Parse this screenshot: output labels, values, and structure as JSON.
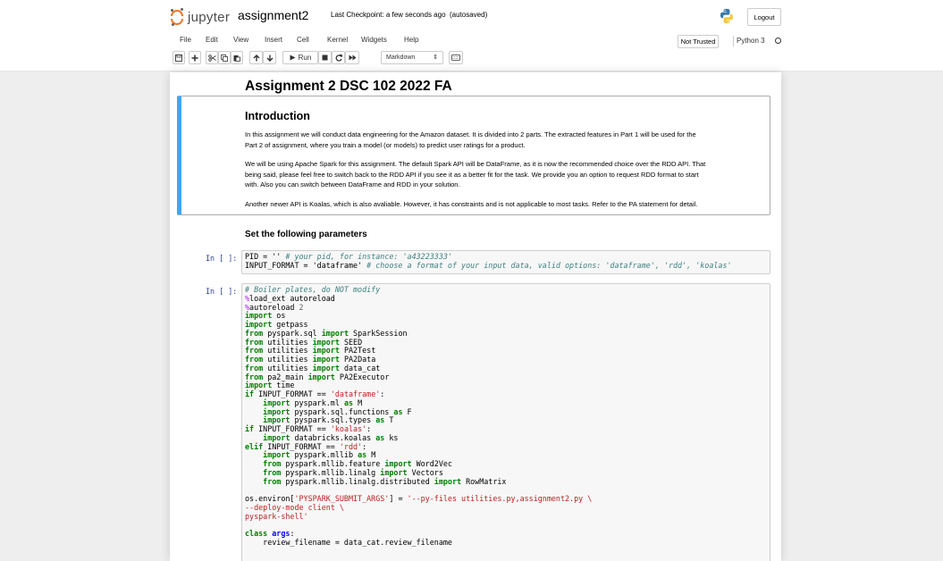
{
  "header": {
    "logo_text": "jupyter",
    "notebook_name": "assignment2",
    "checkpoint": "Last Checkpoint: a few seconds ago",
    "autosave": "(autosaved)",
    "logout_label": "Logout"
  },
  "menubar": {
    "items": [
      "File",
      "Edit",
      "View",
      "Insert",
      "Cell",
      "Kernel",
      "Widgets",
      "Help"
    ],
    "trust_label": "Not Trusted",
    "kernel_name": "Python 3"
  },
  "toolbar": {
    "run_label": "Run",
    "cell_type": "Markdown"
  },
  "notebook": {
    "title": "Assignment 2 DSC 102 2022 FA",
    "intro_heading": "Introduction",
    "intro_p1_line1": "In this assignment we will conduct data engineering for the Amazon dataset. It is divided into 2 parts. The extracted features in Part 1 will be used for the",
    "intro_p1_line2": "Part 2 of assignment, where you train a model (or models) to predict user ratings for a product.",
    "intro_p2_line1": "We will be using Apache Spark for this assignment. The default Spark API will be DataFrame, as it is now the recommended choice over the RDD API. That",
    "intro_p2_line2": "being said, please feel free to switch back to the RDD API if you see it as a better fit for the task. We provide you an option to request RDD format to start",
    "intro_p2_line3": "with. Also you can switch between DataFrame and RDD in your solution.",
    "intro_p3": "Another newer API is Koalas, which is also avaliable. However, it has constraints and is not applicable to most tasks. Refer to the PA statement for detail.",
    "params_heading": "Set the following parameters",
    "prompt": "In [ ]:"
  },
  "code_cells": {
    "params": {
      "l1_a": "PID = '' ",
      "l1_b": "# your pid, for instance: 'a43223333'",
      "l2_a": "INPUT_FORMAT = 'dataframe' ",
      "l2_b": "# choose a format of your input data, valid options: 'dataframe', 'rdd', 'koalas'"
    },
    "boiler": {
      "c1": "# Boiler plates, do NOT modify",
      "l2a": "%",
      "l2b": "load_ext autoreload",
      "l3a": "%",
      "l3b": "autoreload ",
      "l3c": "2",
      "l4a": "import",
      "l4b": " os",
      "l5a": "import",
      "l5b": " getpass",
      "l6a": "from",
      "l6b": " pyspark.sql ",
      "l6c": "import",
      "l6d": " SparkSession",
      "l7a": "from",
      "l7b": " utilities ",
      "l7c": "import",
      "l7d": " SEED",
      "l8a": "from",
      "l8b": " utilities ",
      "l8c": "import",
      "l8d": " PA2Test",
      "l9a": "from",
      "l9b": " utilities ",
      "l9c": "import",
      "l9d": " PA2Data",
      "l10a": "from",
      "l10b": " utilities ",
      "l10c": "import",
      "l10d": " data_cat",
      "l11a": "from",
      "l11b": " pa2_main ",
      "l11c": "import",
      "l11d": " PA2Executor",
      "l12a": "import",
      "l12b": " time",
      "l13a": "if",
      "l13b": " INPUT_FORMAT == ",
      "l13c": "'dataframe'",
      "l13d": ":",
      "l14a": "    import",
      "l14b": " pyspark.ml ",
      "l14c": "as",
      "l14d": " M",
      "l15a": "    import",
      "l15b": " pyspark.sql.functions ",
      "l15c": "as",
      "l15d": " F",
      "l16a": "    import",
      "l16b": " pyspark.sql.types ",
      "l16c": "as",
      "l16d": " T",
      "l17a": "if",
      "l17b": " INPUT_FORMAT == ",
      "l17c": "'koalas'",
      "l17d": ":",
      "l18a": "    import",
      "l18b": " databricks.koalas ",
      "l18c": "as",
      "l18d": " ks",
      "l19a": "elif",
      "l19b": " INPUT_FORMAT == ",
      "l19c": "'rdd'",
      "l19d": ":",
      "l20a": "    import",
      "l20b": " pyspark.mllib ",
      "l20c": "as",
      "l20d": " M",
      "l21a": "    from",
      "l21b": " pyspark.mllib.feature ",
      "l21c": "import",
      "l21d": " Word2Vec",
      "l22a": "    from",
      "l22b": " pyspark.mllib.linalg ",
      "l22c": "import",
      "l22d": " Vectors",
      "l23a": "    from",
      "l23b": " pyspark.mllib.linalg.distributed ",
      "l23c": "import",
      "l23d": " RowMatrix",
      "l25a": "os.environ[",
      "l25b": "'PYSPARK_SUBMIT_ARGS'",
      "l25c": "] = ",
      "l25d": "'--py-files utilities.py,assignment2.py \\",
      "l26": "--deploy-mode client \\",
      "l27": "pyspark-shell'",
      "l29a": "class",
      "l29b": " args",
      "l29c": ":",
      "l30": "    review_filename = data_cat.review_filename"
    }
  }
}
